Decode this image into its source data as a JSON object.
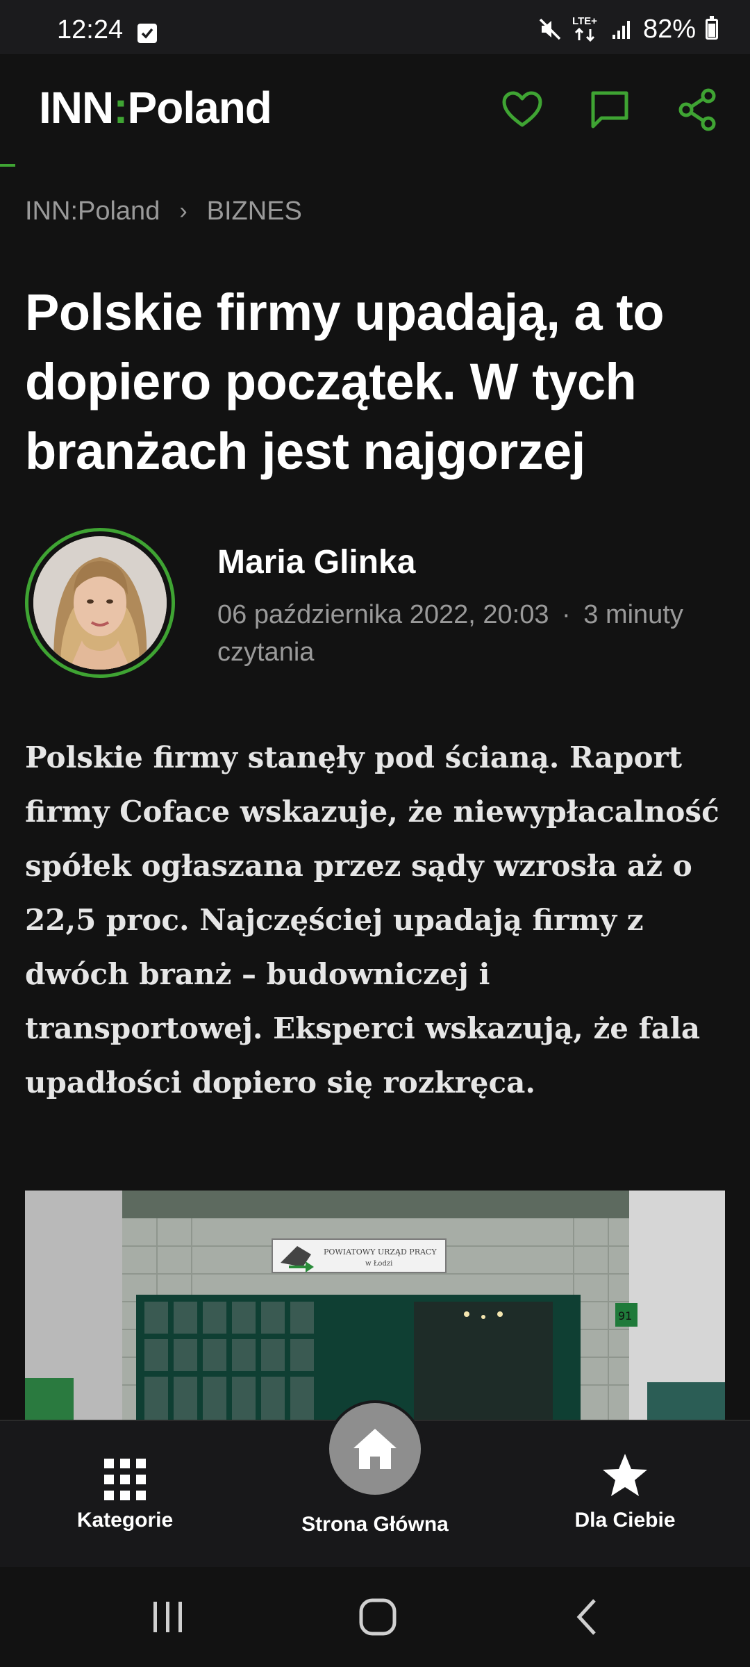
{
  "status_bar": {
    "time": "12:24",
    "network": "LTE+",
    "battery": "82%"
  },
  "header": {
    "logo_left": "INN",
    "logo_colon": ":",
    "logo_right": "Poland",
    "icons": [
      "heart-icon",
      "comment-icon",
      "share-icon"
    ],
    "accent_color": "#3fa433"
  },
  "breadcrumb": {
    "items": [
      "INN:Poland",
      "BIZNES"
    ],
    "separator": "›"
  },
  "article": {
    "title": "Polskie firmy upadają, a to dopiero początek. W tych branżach jest najgorzej",
    "author": "Maria Glinka",
    "date": "06 października 2022, 20:03",
    "dot": "·",
    "read_time": "3 minuty czytania",
    "lead": "Polskie firmy stanęły pod ścianą. Raport firmy Coface wskazuje, że niewypłacalność spółek ogłaszana przez sądy wzrosła aż o 22,5 proc. Najczęściej upadają firmy z dwóch branż – budowniczej i transportowej. Eksperci wskazują, że fala upadłości dopiero się rozkręca.",
    "image_sign_line1": "POWIATOWY URZĄD PRACY",
    "image_sign_line2": "w Łodzi",
    "image_number": "91"
  },
  "bottom_nav": {
    "categories": "Kategorie",
    "home": "Strona Główna",
    "for_you": "Dla Ciebie"
  }
}
